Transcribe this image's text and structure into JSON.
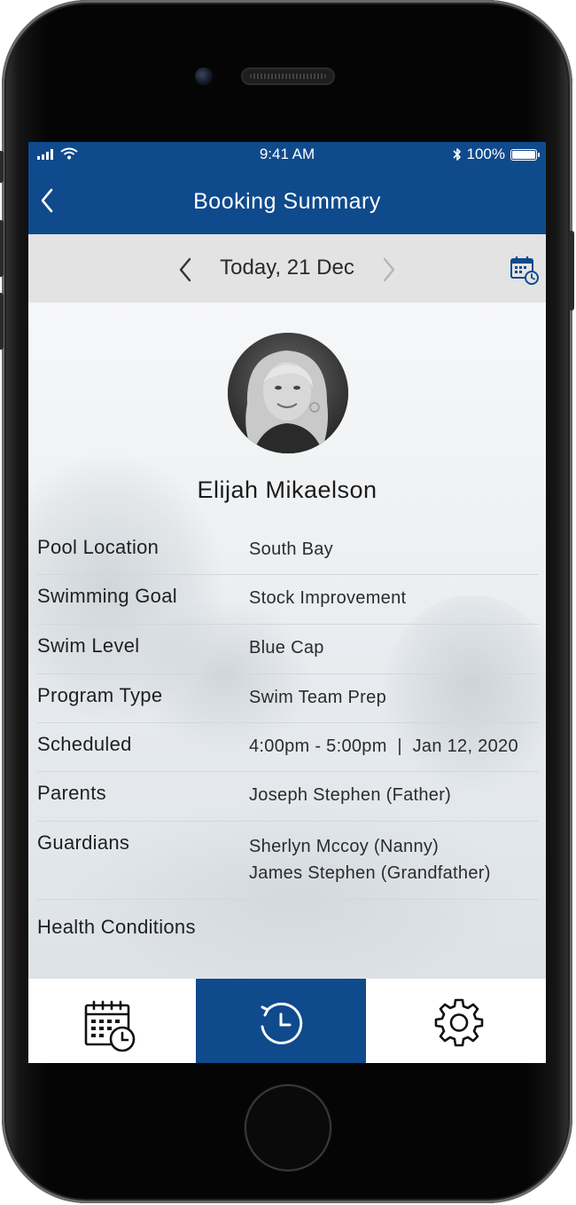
{
  "status_bar": {
    "time": "9:41 AM",
    "battery": "100%",
    "icons": [
      "signal-icon",
      "wifi-icon",
      "bluetooth-icon",
      "battery-icon"
    ]
  },
  "header": {
    "title": "Booking Summary",
    "back_icon": "chevron-left-icon"
  },
  "date_nav": {
    "label": "Today, 21 Dec",
    "prev_icon": "chevron-left-icon",
    "next_icon": "chevron-right-icon",
    "calendar_icon": "calendar-clock-icon"
  },
  "profile": {
    "name": "Elijah Mikaelson"
  },
  "details": [
    {
      "label": "Pool Location",
      "values": [
        "South Bay"
      ]
    },
    {
      "label": "Swimming Goal",
      "values": [
        "Stock Improvement"
      ]
    },
    {
      "label": "Swim Level",
      "values": [
        "Blue Cap"
      ]
    },
    {
      "label": "Program Type",
      "values": [
        "Swim Team Prep"
      ]
    },
    {
      "label": "Scheduled",
      "values": [
        "4:00pm - 5:00pm  |  Jan 12, 2020"
      ]
    },
    {
      "label": "Parents",
      "values": [
        "Joseph Stephen (Father)"
      ]
    },
    {
      "label": "Guardians",
      "values": [
        "Sherlyn Mccoy (Nanny)",
        "James Stephen (Grandfather)"
      ]
    },
    {
      "label": "Health Conditions",
      "values": [
        ""
      ]
    }
  ],
  "tab_bar": {
    "tabs": [
      {
        "icon": "calendar-schedule-icon",
        "active": false
      },
      {
        "icon": "history-icon",
        "active": true
      },
      {
        "icon": "gear-icon",
        "active": false
      }
    ]
  },
  "colors": {
    "primary": "#0f4a8c",
    "date_bar": "#e3e3e3",
    "text": "#1f1f1f"
  }
}
